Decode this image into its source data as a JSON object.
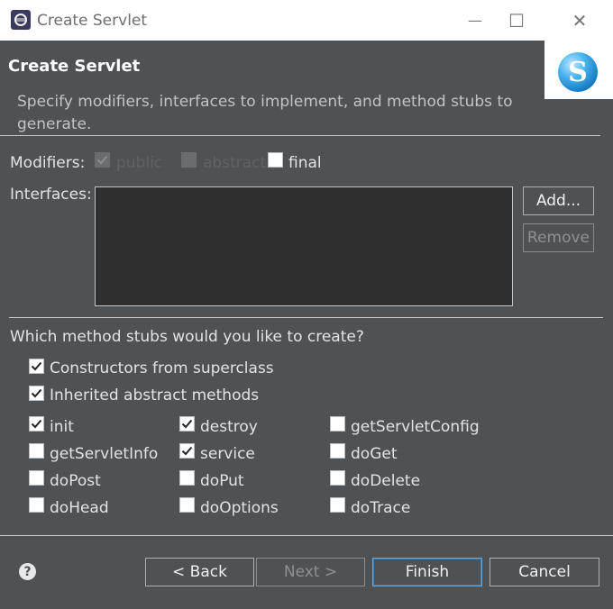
{
  "window": {
    "title": "Create Servlet",
    "minimize_glyph": "—",
    "maximize_glyph": "☐",
    "close_glyph": "✕"
  },
  "header": {
    "title": "Create Servlet",
    "description": "Specify modifiers, interfaces to implement, and method stubs to generate.",
    "logo_letter": "S"
  },
  "modifiers": {
    "label": "Modifiers:",
    "items": [
      {
        "label": "public",
        "checked": true,
        "enabled": false
      },
      {
        "label": "abstract",
        "checked": false,
        "enabled": false
      },
      {
        "label": "final",
        "checked": false,
        "enabled": true
      }
    ]
  },
  "interfaces": {
    "label": "Interfaces:",
    "add_label": "Add...",
    "remove_label": "Remove"
  },
  "stubs": {
    "question": "Which method stubs would you like to create?",
    "constructors": {
      "label": "Constructors from superclass",
      "checked": true
    },
    "inherited": {
      "label": "Inherited abstract methods",
      "checked": true
    },
    "methods": [
      {
        "label": "init",
        "checked": true
      },
      {
        "label": "destroy",
        "checked": true
      },
      {
        "label": "getServletConfig",
        "checked": false
      },
      {
        "label": "getServletInfo",
        "checked": false
      },
      {
        "label": "service",
        "checked": true
      },
      {
        "label": "doGet",
        "checked": false
      },
      {
        "label": "doPost",
        "checked": false
      },
      {
        "label": "doPut",
        "checked": false
      },
      {
        "label": "doDelete",
        "checked": false
      },
      {
        "label": "doHead",
        "checked": false
      },
      {
        "label": "doOptions",
        "checked": false
      },
      {
        "label": "doTrace",
        "checked": false
      }
    ]
  },
  "footer": {
    "help_glyph": "?",
    "back_label": "< Back",
    "next_label": "Next >",
    "finish_label": "Finish",
    "cancel_label": "Cancel"
  },
  "colors": {
    "background": "#4f5254",
    "accent": "#66a8dd"
  }
}
